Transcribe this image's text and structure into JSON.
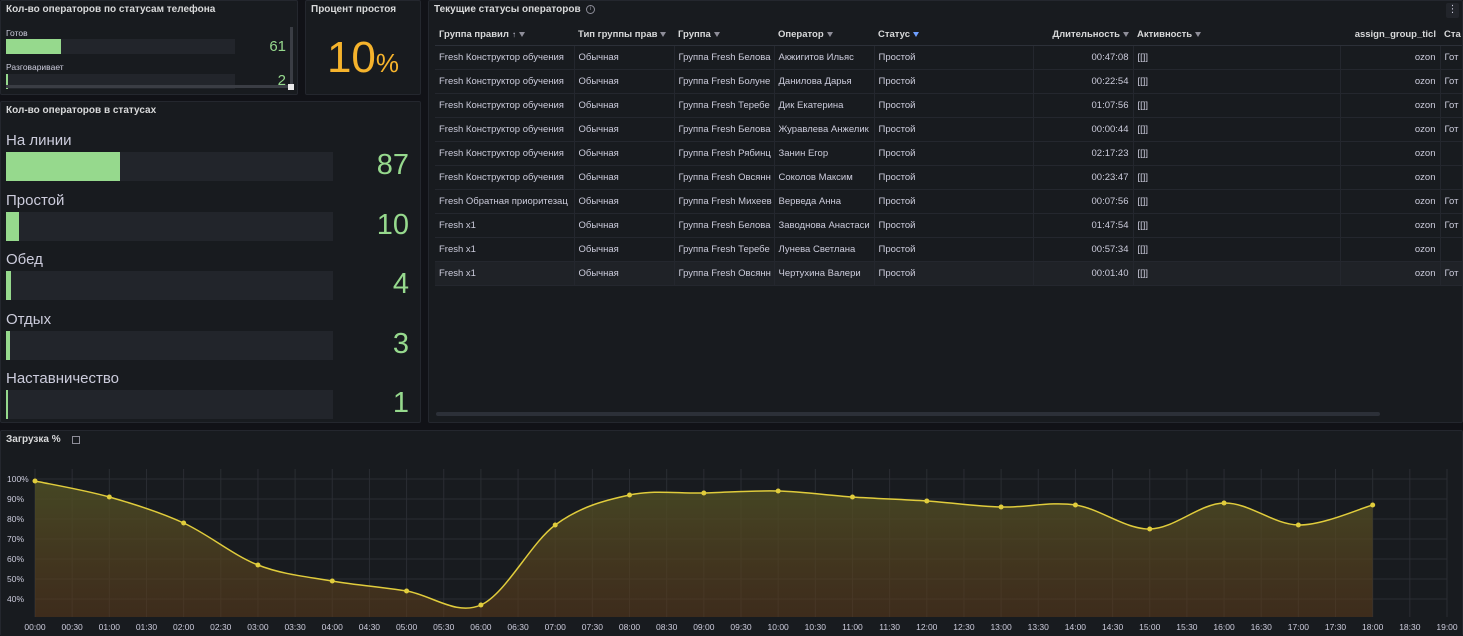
{
  "phone_panel": {
    "title": "Кол-во операторов по статусам телефона",
    "rows": [
      {
        "label": "Готов",
        "value": "61",
        "fill": 0.24
      },
      {
        "label": "Разговаривает",
        "value": "2",
        "fill": 0.01
      }
    ]
  },
  "idle_panel": {
    "title": "Процент простоя",
    "value": "10",
    "unit": "%"
  },
  "status_panel": {
    "title": "Кол-во операторов в статусах",
    "rows": [
      {
        "label": "На линии",
        "value": "87",
        "fill": 0.35
      },
      {
        "label": "Простой",
        "value": "10",
        "fill": 0.04
      },
      {
        "label": "Обед",
        "value": "4",
        "fill": 0.015
      },
      {
        "label": "Отдых",
        "value": "3",
        "fill": 0.012
      },
      {
        "label": "Наставничество",
        "value": "1",
        "fill": 0.004
      }
    ]
  },
  "table_panel": {
    "title": "Текущие статусы операторов",
    "columns": [
      "Группа правил",
      "Тип группы прав",
      "Группа",
      "Оператор",
      "Статус",
      "Длительность",
      "Активность",
      "assign_group_ticl",
      "Ста"
    ],
    "rows": [
      [
        "Fresh Конструктор обучения",
        "Обычная",
        "Группа Fresh Белова",
        "Акжигитов Ильяс",
        "Простой",
        "00:47:08",
        "[[]]",
        "ozon",
        "Гот"
      ],
      [
        "Fresh Конструктор обучения",
        "Обычная",
        "Группа Fresh Болуне",
        "Данилова Дарья",
        "Простой",
        "00:22:54",
        "[[]]",
        "ozon",
        "Гот"
      ],
      [
        "Fresh Конструктор обучения",
        "Обычная",
        "Группа Fresh Теребе",
        "Дик Екатерина",
        "Простой",
        "01:07:56",
        "[[]]",
        "ozon",
        "Гот"
      ],
      [
        "Fresh Конструктор обучения",
        "Обычная",
        "Группа Fresh Белова",
        "Журавлева Анжелик",
        "Простой",
        "00:00:44",
        "[[]]",
        "ozon",
        "Гот"
      ],
      [
        "Fresh Конструктор обучения",
        "Обычная",
        "Группа Fresh Рябинц",
        "Занин Егор",
        "Простой",
        "02:17:23",
        "[[]]",
        "ozon",
        ""
      ],
      [
        "Fresh Конструктор обучения",
        "Обычная",
        "Группа Fresh Овсянн",
        "Соколов Максим",
        "Простой",
        "00:23:47",
        "[[]]",
        "ozon",
        ""
      ],
      [
        "Fresh Обратная приоритезац",
        "Обычная",
        "Группа Fresh Михеев",
        "Верведа Анна",
        "Простой",
        "00:07:56",
        "[[]]",
        "ozon",
        "Гот"
      ],
      [
        "Fresh x1",
        "Обычная",
        "Группа Fresh Белова",
        "Заводнова Анастаси",
        "Простой",
        "01:47:54",
        "[[]]",
        "ozon",
        "Гот"
      ],
      [
        "Fresh x1",
        "Обычная",
        "Группа Fresh Теребе",
        "Лунева Светлана",
        "Простой",
        "00:57:34",
        "[[]]",
        "ozon",
        ""
      ],
      [
        "Fresh x1",
        "Обычная",
        "Группа Fresh Овсянн",
        "Чертухина Валери",
        "Простой",
        "00:01:40",
        "[[]]",
        "ozon",
        "Гот"
      ]
    ]
  },
  "chart_data": {
    "type": "area",
    "title": "Загрузка %",
    "x": [
      "00:00",
      "01:00",
      "02:00",
      "03:00",
      "04:00",
      "05:00",
      "06:00",
      "07:00",
      "08:00",
      "09:00",
      "10:00",
      "11:00",
      "12:00",
      "13:00",
      "14:00",
      "15:00",
      "16:00",
      "17:00",
      "18:00"
    ],
    "series": [
      {
        "values": [
          99,
          91,
          78,
          57,
          49,
          44,
          37,
          77,
          92,
          93,
          94,
          91,
          89,
          86,
          87,
          75,
          88,
          77,
          87
        ]
      }
    ],
    "x_ticks": [
      "00:00",
      "00:30",
      "01:00",
      "01:30",
      "02:00",
      "02:30",
      "03:00",
      "03:30",
      "04:00",
      "04:30",
      "05:00",
      "05:30",
      "06:00",
      "06:30",
      "07:00",
      "07:30",
      "08:00",
      "08:30",
      "09:00",
      "09:30",
      "10:00",
      "10:30",
      "11:00",
      "11:30",
      "12:00",
      "12:30",
      "13:00",
      "13:30",
      "14:00",
      "14:30",
      "15:00",
      "15:30",
      "16:00",
      "16:30",
      "17:00",
      "17:30",
      "18:00",
      "18:30",
      "19:00"
    ],
    "y_ticks": [
      "40%",
      "50%",
      "60%",
      "70%",
      "80%",
      "90%",
      "100%"
    ],
    "ylim": [
      31,
      105
    ],
    "grid": true,
    "colors": {
      "line": "#e0cc3c",
      "fill_top": "#4d4f25",
      "fill_bottom": "#5c3a1a"
    }
  }
}
